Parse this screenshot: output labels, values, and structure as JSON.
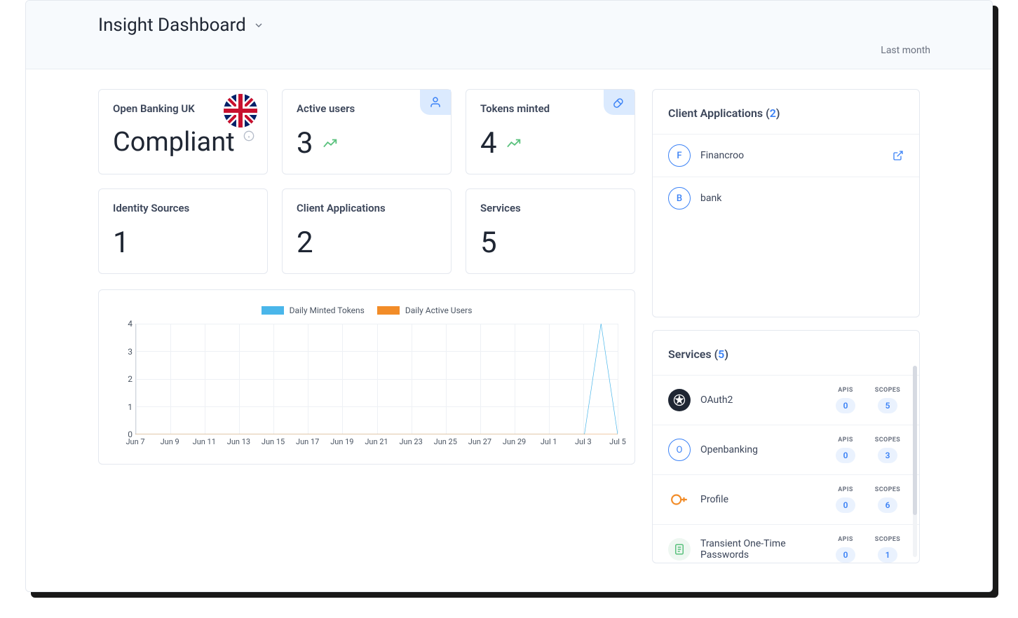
{
  "header": {
    "title": "Insight Dashboard",
    "time_filter": "Last month"
  },
  "stats": {
    "compliance": {
      "title": "Open Banking UK",
      "status": "Compliant"
    },
    "active_users": {
      "title": "Active users",
      "value": "3"
    },
    "tokens_minted": {
      "title": "Tokens minted",
      "value": "4"
    },
    "identity_sources": {
      "title": "Identity Sources",
      "value": "1"
    },
    "client_apps": {
      "title": "Client Applications",
      "value": "2"
    },
    "services": {
      "title": "Services",
      "value": "5"
    }
  },
  "chart_data": {
    "type": "line",
    "title": "",
    "xlabel": "",
    "ylabel": "",
    "ylim": [
      0,
      4
    ],
    "y_ticks": [
      0,
      1,
      2,
      3,
      4
    ],
    "categories": [
      "Jun 7",
      "Jun 9",
      "Jun 11",
      "Jun 13",
      "Jun 15",
      "Jun 17",
      "Jun 19",
      "Jun 21",
      "Jun 23",
      "Jun 25",
      "Jun 27",
      "Jun 29",
      "Jul 1",
      "Jul 3",
      "Jul 5"
    ],
    "series": [
      {
        "name": "Daily Minted Tokens",
        "color": "#4ab6ea",
        "values": [
          0,
          0,
          0,
          0,
          0,
          0,
          0,
          0,
          0,
          0,
          0,
          0,
          0,
          0,
          0,
          0,
          0,
          0,
          0,
          0,
          0,
          0,
          0,
          0,
          0,
          0,
          0,
          0,
          4,
          0
        ]
      },
      {
        "name": "Daily Active Users",
        "color": "#f28c28",
        "values": [
          0,
          0,
          0,
          0,
          0,
          0,
          0,
          0,
          0,
          0,
          0,
          0,
          0,
          0,
          0,
          0,
          0,
          0,
          0,
          0,
          0,
          0,
          0,
          0,
          0,
          0,
          0,
          0,
          0,
          0
        ]
      }
    ]
  },
  "client_panel": {
    "title": "Client Applications",
    "count": "2",
    "items": [
      {
        "initial": "F",
        "name": "Financroo",
        "has_link": true
      },
      {
        "initial": "B",
        "name": "bank",
        "has_link": false
      }
    ]
  },
  "services_panel": {
    "title": "Services",
    "count": "5",
    "apis_label": "APIS",
    "scopes_label": "SCOPES",
    "items": [
      {
        "name": "OAuth2",
        "apis": "0",
        "scopes": "5",
        "avatar_style": "dark"
      },
      {
        "name": "Openbanking",
        "apis": "0",
        "scopes": "3",
        "avatar_style": "ring",
        "initial": "O"
      },
      {
        "name": "Profile",
        "apis": "0",
        "scopes": "6",
        "avatar_style": "profile"
      },
      {
        "name": "Transient One-Time Passwords",
        "apis": "0",
        "scopes": "1",
        "avatar_style": "doc"
      }
    ]
  }
}
